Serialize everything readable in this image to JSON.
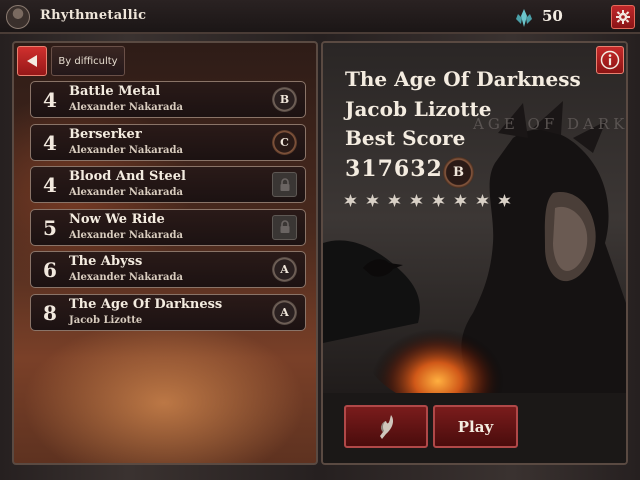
{
  "header": {
    "profile_name": "Rhythmetallic",
    "gem_count": "50",
    "gem_icon": "crystal-gem-icon",
    "settings_icon": "gear-icon"
  },
  "song_list": {
    "back_icon": "arrow-left-icon",
    "sort_label": "By difficulty",
    "songs": [
      {
        "level": "4",
        "title": "Battle Metal",
        "artist": "Alexander Nakarada",
        "grade": "B",
        "locked": false
      },
      {
        "level": "4",
        "title": "Berserker",
        "artist": "Alexander Nakarada",
        "grade": "C",
        "locked": false
      },
      {
        "level": "4",
        "title": "Blood And Steel",
        "artist": "Alexander Nakarada",
        "grade": "",
        "locked": true
      },
      {
        "level": "5",
        "title": "Now We Ride",
        "artist": "Alexander Nakarada",
        "grade": "",
        "locked": true
      },
      {
        "level": "6",
        "title": "The Abyss",
        "artist": "Alexander Nakarada",
        "grade": "A",
        "locked": false
      },
      {
        "level": "8",
        "title": "The Age Of Darkness",
        "artist": "Jacob Lizotte",
        "grade": "A",
        "locked": false
      }
    ]
  },
  "detail": {
    "title": "The Age Of Darkness",
    "artist": "Jacob Lizotte",
    "best_score_label": "Best Score",
    "best_score": "317632",
    "best_grade": "B",
    "stars_earned": 0,
    "stars_total": 8,
    "cover_text": "AGE OF DARKN",
    "info_icon": "info-icon",
    "equip_icon": "blade-icon",
    "play_label": "Play"
  },
  "colors": {
    "accent_red": "#c0282a",
    "gem_teal": "#5fb8c0"
  }
}
